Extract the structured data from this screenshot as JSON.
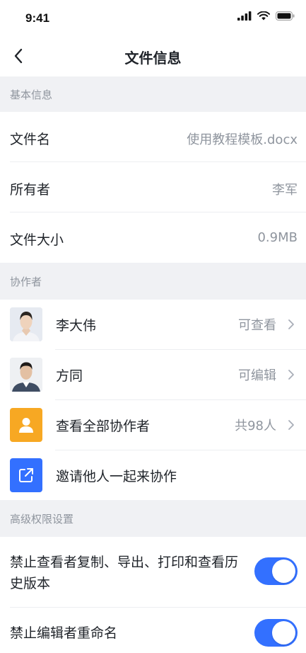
{
  "status_bar": {
    "time": "9:41",
    "icons": [
      "signal-icon",
      "wifi-icon",
      "battery-icon"
    ]
  },
  "nav": {
    "back_icon": "chevron-left-icon",
    "title": "文件信息"
  },
  "basic_info": {
    "header": "基本信息",
    "rows": [
      {
        "label": "文件名",
        "value": "使用教程模板.docx"
      },
      {
        "label": "所有者",
        "value": "李军"
      },
      {
        "label": "文件大小",
        "value": "0.9MB"
      }
    ]
  },
  "collaborators": {
    "header": "协作者",
    "people": [
      {
        "name": "李大伟",
        "permission": "可查看"
      },
      {
        "name": "方同",
        "permission": "可编辑"
      }
    ],
    "view_all": {
      "label": "查看全部协作者",
      "count": "共98人",
      "icon": "person-icon"
    },
    "invite": {
      "label": "邀请他人一起来协作",
      "icon": "share-icon"
    }
  },
  "advanced": {
    "header": "高级权限设置",
    "settings": [
      {
        "label": "禁止查看者复制、导出、打印和查看历史版本",
        "enabled": true
      },
      {
        "label": "禁止编辑者重命名",
        "enabled": true
      }
    ]
  },
  "colors": {
    "accent": "#3370ff",
    "section_bg": "#f0f1f4",
    "secondary_text": "#8f959e",
    "orange_tile": "#f7a823",
    "blue_tile": "#3370ff"
  }
}
